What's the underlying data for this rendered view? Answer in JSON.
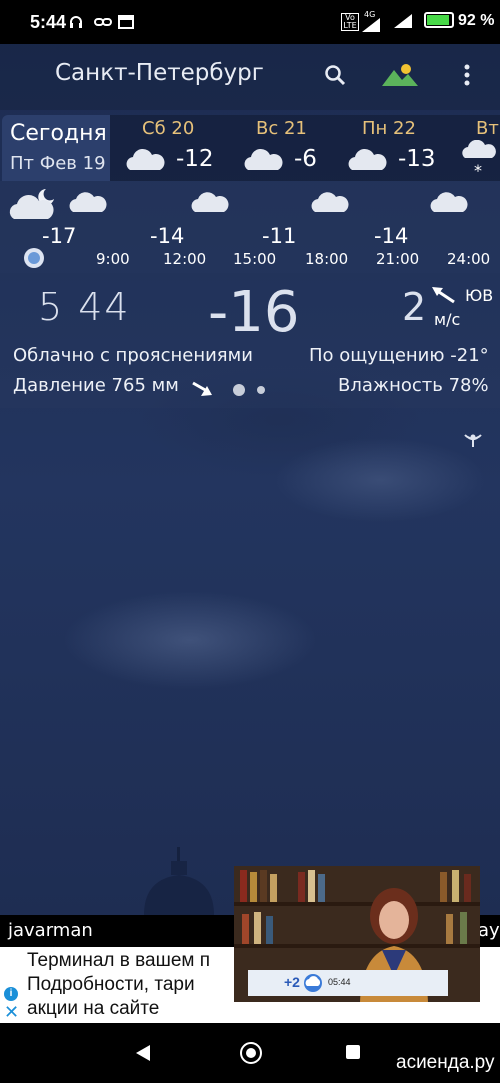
{
  "status_bar": {
    "time": "5:44",
    "network": "4G",
    "volte": "Vo LTE",
    "battery_percent_label": "92 %",
    "battery_level": 0.92,
    "battery_color": "#48d848"
  },
  "toolbar": {
    "city": "Санкт-Петербург",
    "search_icon": "search-icon",
    "wallpaper_icon": "landscape-icon",
    "menu_icon": "more-vert-icon"
  },
  "days": {
    "today": {
      "name": "Сегодня",
      "date": "Пт Фев 19"
    },
    "items": [
      {
        "name": "Сб 20",
        "temp": "-12",
        "icon": "cloud-icon"
      },
      {
        "name": "Вс 21",
        "temp": "-6",
        "icon": "cloud-icon"
      },
      {
        "name": "Пн 22",
        "temp": "-13",
        "icon": "cloud-icon"
      },
      {
        "name": "Вт",
        "temp": "",
        "icon": "snow-cloud-icon"
      }
    ]
  },
  "hourly": {
    "temps": [
      "-17",
      "-14",
      "-11",
      "-14"
    ],
    "times": [
      "9:00",
      "12:00",
      "15:00",
      "18:00",
      "21:00",
      "24:00"
    ]
  },
  "current": {
    "sunrise_time": "5 44",
    "temperature": "-16",
    "wind_speed": "2",
    "wind_direction": "ЮВ",
    "wind_unit": "м/с",
    "condition": "Облачно с прояснениями",
    "feels_like": "По ощущению -21°",
    "pressure": "Давление 765 мм",
    "humidity": "Влажность 78%"
  },
  "ad": {
    "username": "javarman",
    "right_text": "ay",
    "lines": [
      "Терминал в вашем п",
      "Подробности, тари",
      "акции на сайте"
    ],
    "pip_badge": "+2",
    "pip_time": "05:44"
  },
  "watermark": "асиенда.ру"
}
